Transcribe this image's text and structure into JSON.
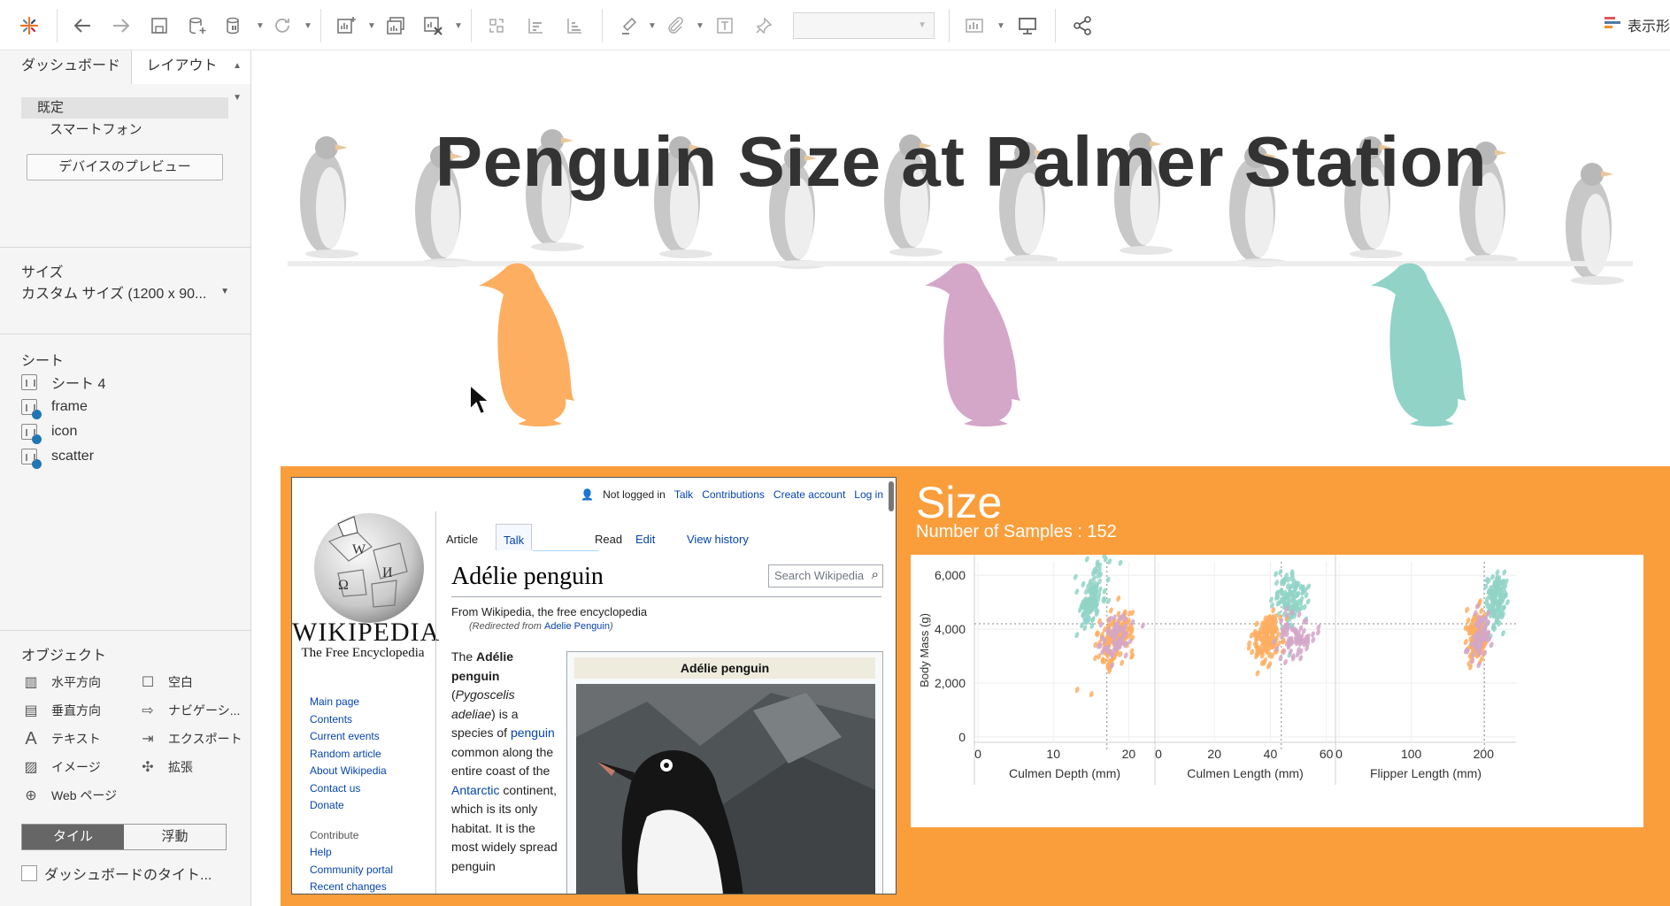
{
  "toolbar": {
    "right_label": "表示形",
    "buttons": [
      "tableau-logo-icon",
      "back-icon",
      "forward-icon",
      "save-icon",
      "new-datasource-icon",
      "pause-updates-icon",
      "refresh-icon",
      "new-worksheet-icon",
      "duplicate-sheet-icon",
      "clear-sheet-icon",
      "swap-icon",
      "sort-asc-icon",
      "sort-desc-icon",
      "highlight-icon",
      "tooltip-icon",
      "label-icon",
      "pin-icon",
      "fit-icon",
      "presentation-icon",
      "share-icon"
    ]
  },
  "sidebar": {
    "tabs": {
      "dashboard": "ダッシュボード",
      "layout": "レイアウト"
    },
    "device": {
      "default": "既定",
      "phone": "スマートフォン",
      "preview": "デバイスのプレビュー"
    },
    "size": {
      "title": "サイズ",
      "value": "カスタム サイズ (1200 x 90..."
    },
    "sheets": {
      "title": "シート",
      "items": [
        "シート 4",
        "frame",
        "icon",
        "scatter"
      ]
    },
    "objects": {
      "title": "オブジェクト",
      "items": [
        {
          "label": "水平方向",
          "icon": "horizontal-icon"
        },
        {
          "label": "空白",
          "icon": "blank-icon"
        },
        {
          "label": "垂直方向",
          "icon": "vertical-icon"
        },
        {
          "label": "ナビゲーシ...",
          "icon": "navigation-icon"
        },
        {
          "label": "テキスト",
          "icon": "text-icon"
        },
        {
          "label": "エクスポート",
          "icon": "export-icon"
        },
        {
          "label": "イメージ",
          "icon": "image-icon"
        },
        {
          "label": "拡張",
          "icon": "extension-icon"
        },
        {
          "label": "Web ページ",
          "icon": "web-icon"
        }
      ],
      "tile": "タイル",
      "float": "浮動",
      "show_title": "ダッシュボードのタイト..."
    }
  },
  "dashboard": {
    "title": "Penguin Size at Palmer Station",
    "species_colors": [
      "#fdae61",
      "#d4a6c8",
      "#91d3c7"
    ]
  },
  "wiki": {
    "not_logged": "Not logged in",
    "top_links": [
      "Talk",
      "Contributions",
      "Create account",
      "Log in"
    ],
    "wordmark": "WIKIPEDIA",
    "tagline": "The Free Encyclopedia",
    "nav": [
      "Main page",
      "Contents",
      "Current events",
      "Random article",
      "About Wikipedia",
      "Contact us",
      "Donate"
    ],
    "contribute_title": "Contribute",
    "contribute": [
      "Help",
      "Community portal",
      "Recent changes"
    ],
    "tabs": {
      "article": "Article",
      "talk": "Talk",
      "read": "Read",
      "edit": "Edit",
      "history": "View history"
    },
    "search_placeholder": "Search Wikipedia",
    "title": "Adélie penguin",
    "from": "From Wikipedia, the free encyclopedia",
    "redirect_prefix": "(Redirected from ",
    "redirect_link": "Adelie Penguin",
    "redirect_suffix": ")",
    "body": {
      "t1": "The ",
      "b1": "Adélie penguin",
      "t2": " (",
      "i1": "Pygoscelis adeliae",
      "t3": ") is a species of ",
      "l1": "penguin",
      "t4": " common along the entire coast of the ",
      "l2": "Antarctic",
      "t5": " continent, which is its only habitat. It is the most widely spread penguin"
    },
    "infobox_title": "Adélie penguin"
  },
  "size_panel": {
    "title": "Size",
    "subtitle": "Number of Samples : 152"
  },
  "chart_data": {
    "type": "scatter",
    "ylabel": "Body Mass (g)",
    "y_ticks": [
      "6,000",
      "4,000",
      "2,000",
      "0"
    ],
    "ylim": [
      -200,
      6500
    ],
    "y_ref": 4200,
    "series_colors": {
      "Adelie": "#fdae61",
      "Chinstrap": "#d4a6c8",
      "Gentoo": "#91d3c7"
    },
    "panels": [
      {
        "xlabel": "Culmen Depth (mm)",
        "ticks": [
          0,
          10,
          20
        ],
        "xlim": [
          0,
          23
        ],
        "x_ref": 17.1,
        "clusters": [
          {
            "species": "Gentoo",
            "cx": 15.0,
            "cy": 5100,
            "sx": 1.0,
            "sy": 500,
            "n": 123,
            "tilt": 300
          },
          {
            "species": "Adelie",
            "cx": 18.3,
            "cy": 3700,
            "sx": 1.2,
            "sy": 450,
            "n": 151,
            "tilt": 200
          },
          {
            "species": "Chinstrap",
            "cx": 18.4,
            "cy": 3730,
            "sx": 1.1,
            "sy": 380,
            "n": 68,
            "tilt": 150
          }
        ]
      },
      {
        "xlabel": "Culmen Length (mm)",
        "ticks": [
          0,
          20,
          40,
          60
        ],
        "xlim": [
          0,
          62
        ],
        "x_ref": 43.9,
        "clusters": [
          {
            "species": "Gentoo",
            "cx": 47.5,
            "cy": 5100,
            "sx": 3.0,
            "sy": 500,
            "n": 123,
            "tilt": 100
          },
          {
            "species": "Adelie",
            "cx": 38.8,
            "cy": 3700,
            "sx": 2.6,
            "sy": 460,
            "n": 151,
            "tilt": 100
          },
          {
            "species": "Chinstrap",
            "cx": 48.8,
            "cy": 3730,
            "sx": 3.2,
            "sy": 380,
            "n": 68,
            "tilt": 60
          }
        ]
      },
      {
        "xlabel": "Flipper Length (mm)",
        "ticks": [
          0,
          100,
          200
        ],
        "xlim": [
          0,
          240
        ],
        "x_ref": 201,
        "clusters": [
          {
            "species": "Gentoo",
            "cx": 217,
            "cy": 5100,
            "sx": 6.5,
            "sy": 500,
            "n": 123,
            "tilt": 60
          },
          {
            "species": "Adelie",
            "cx": 190,
            "cy": 3700,
            "sx": 6.5,
            "sy": 450,
            "n": 151,
            "tilt": 40
          },
          {
            "species": "Chinstrap",
            "cx": 196,
            "cy": 3730,
            "sx": 7.0,
            "sy": 380,
            "n": 68,
            "tilt": 40
          }
        ]
      }
    ]
  }
}
